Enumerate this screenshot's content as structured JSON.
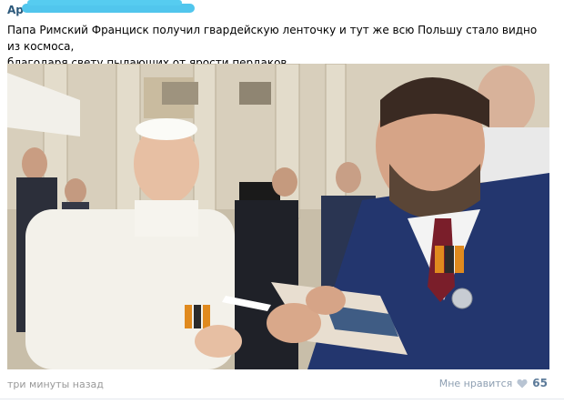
{
  "post": {
    "author_visible": "Ар",
    "text_line1": "Папа Римский Франциск получил гвардейскую ленточку и тут же всю Польшу стало видно из космоса,",
    "text_line2": "благодаря свету пылающих от ярости пердаков.",
    "time": "три минуты назад",
    "like_label": "Мне нравится",
    "like_count": "65"
  },
  "colors": {
    "link": "#2b587a",
    "muted": "#999999",
    "like": "#8e9fb2",
    "scribble": "#48c3ec"
  },
  "icons": {
    "like": "heart-icon"
  }
}
